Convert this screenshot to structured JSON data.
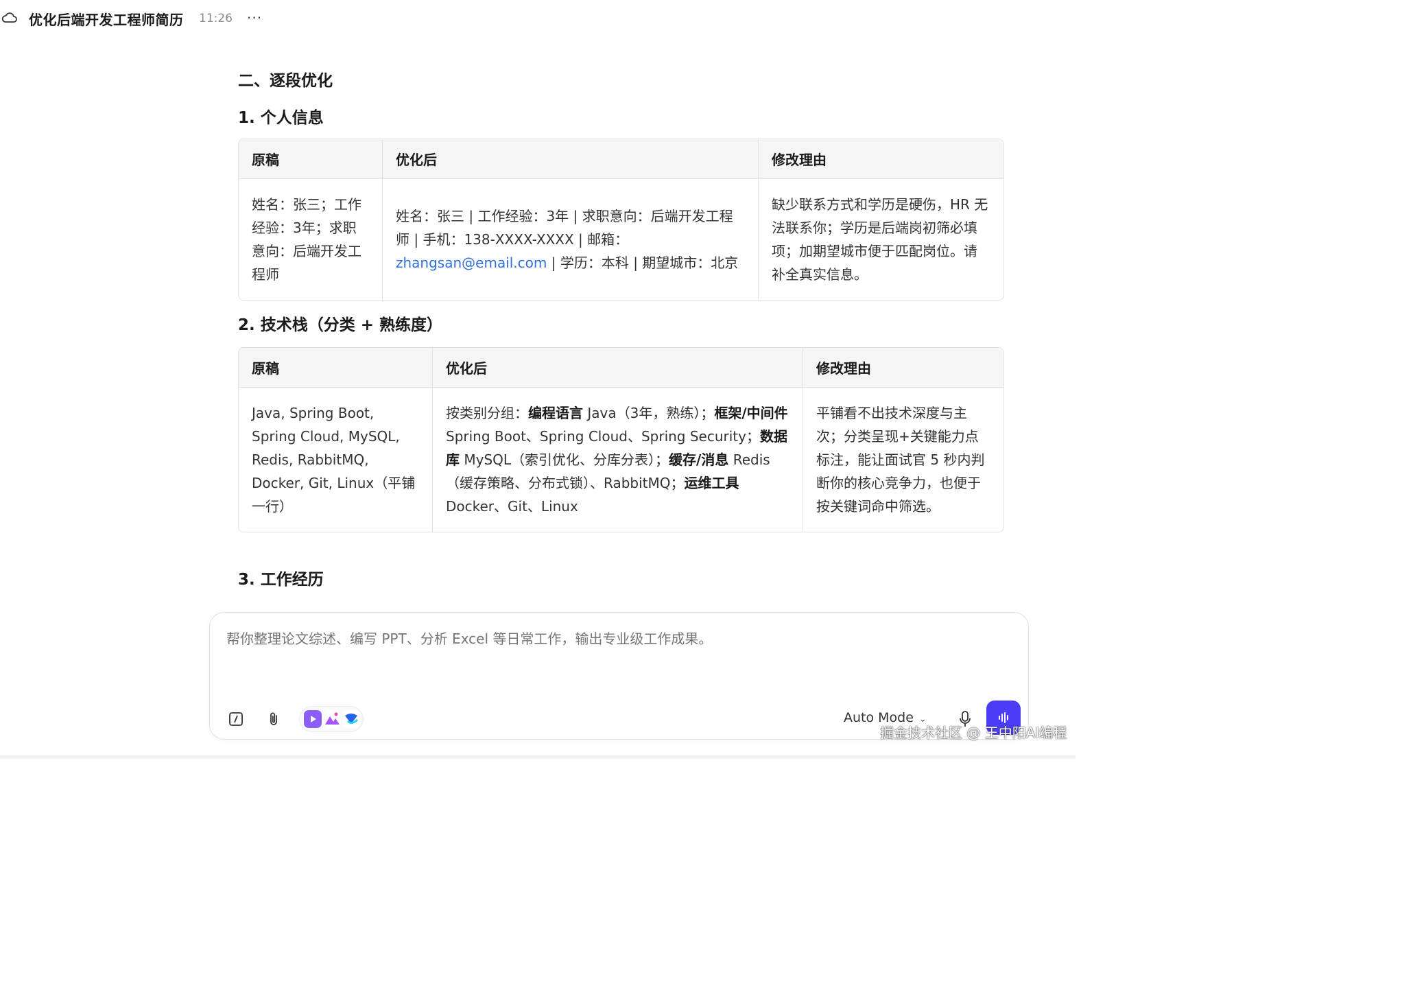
{
  "header": {
    "title": "优化后端开发工程师简历",
    "time": "11:26",
    "more": "···"
  },
  "doc": {
    "section_title": "二、逐段优化",
    "sub1": "1. 个人信息",
    "sub2": "2. 技术栈（分类 + 熟练度）",
    "sub3": "3. 工作经历",
    "table_headers": [
      "原稿",
      "优化后",
      "修改理由"
    ],
    "t1": {
      "original": "姓名：张三；工作经验：3年；求职意向：后端开发工程师",
      "optimized_pre": "姓名：张三 | 工作经验：3年 | 求职意向：后端开发工程师 | 手机：138-XXXX-XXXX | 邮箱：",
      "optimized_email": "zhangsan@email.com",
      "optimized_post": " | 学历：本科 | 期望城市：北京",
      "reason": "缺少联系方式和学历是硬伤，HR 无法联系你；学历是后端岗初筛必填项；加期望城市便于匹配岗位。请补全真实信息。"
    },
    "t2": {
      "original": "Java, Spring Boot, Spring Cloud, MySQL, Redis, RabbitMQ, Docker, Git, Linux（平铺一行）",
      "opt_intro": "按类别分组：",
      "kw_lang": "编程语言",
      "lang_text": " Java（3年，熟练）；",
      "kw_frame": "框架/中间件",
      "frame_text": " Spring Boot、Spring Cloud、Spring Security；",
      "kw_db": "数据库",
      "db_text": " MySQL（索引优化、分库分表）；",
      "kw_cache": "缓存/消息",
      "cache_text": " Redis（缓存策略、分布式锁）、RabbitMQ；",
      "kw_ops": "运维工具",
      "ops_text": " Docker、Git、Linux",
      "reason": "平铺看不出技术深度与主次；分类呈现+关键能力点标注，能让面试官 5 秒内判断你的核心竞争力，也便于按关键词命中筛选。"
    }
  },
  "composer": {
    "placeholder": "帮你整理论文综述、编写 PPT、分析 Excel 等日常工作，输出专业级工作成果。",
    "mode_label": "Auto Mode",
    "icons": [
      "command-icon",
      "paperclip-icon",
      "video-app-icon",
      "image-app-icon",
      "doc-app-icon",
      "mic-icon",
      "voice-send-icon"
    ]
  },
  "watermark": "掘金技术社区 @ 王中阳AI编程",
  "colors": {
    "link": "#2f6fde",
    "send": "#4b3cf5",
    "header_bg": "#f5f5f5"
  }
}
